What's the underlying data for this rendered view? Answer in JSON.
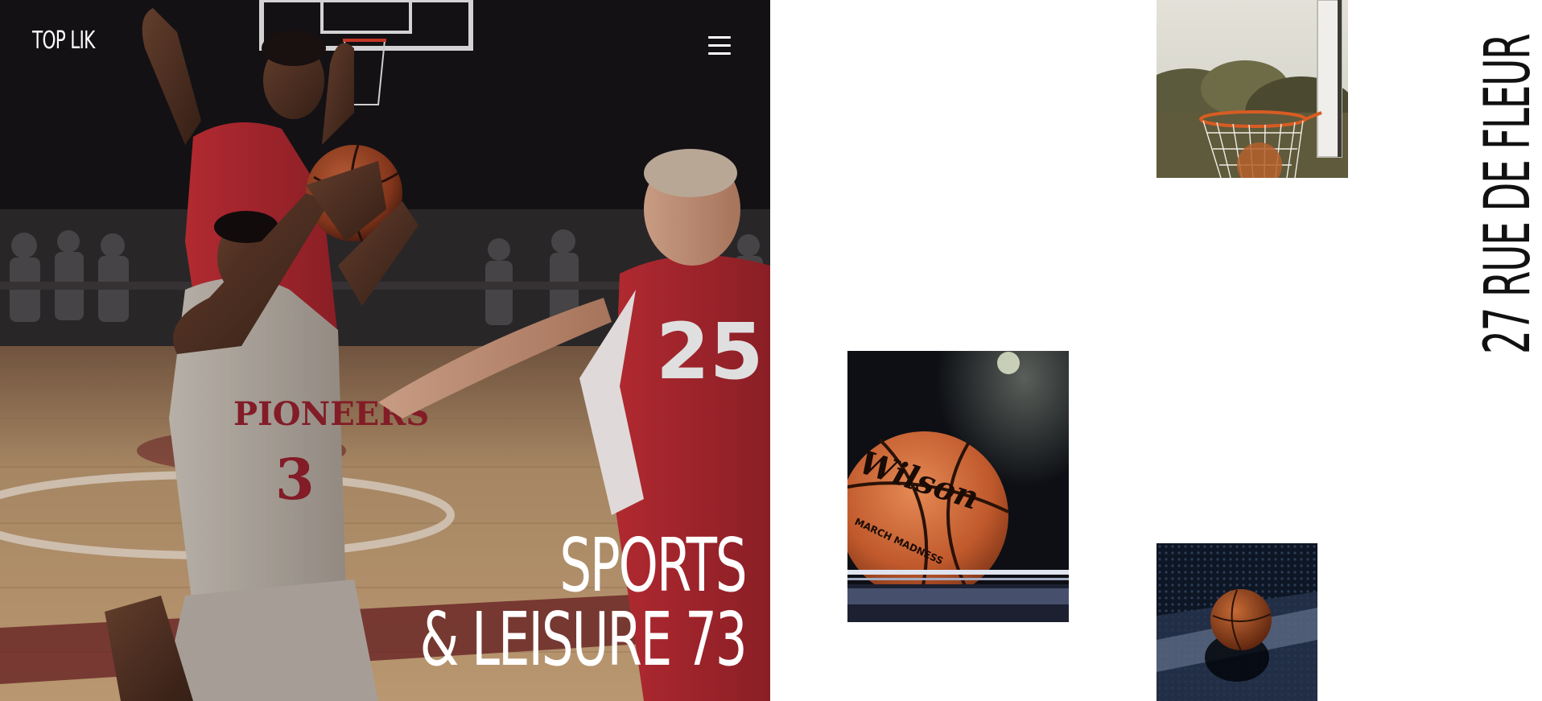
{
  "header": {
    "brand": "TOP LIK",
    "menu_icon": "hamburger-menu-icon"
  },
  "hero": {
    "title_line1": "SPORTS",
    "title_line2": "& LEISURE 73",
    "image": "basketball-players-game-photo",
    "jersey_front_team": "PIONEERS",
    "jersey_front_number": "3",
    "jersey_defender_number": "25"
  },
  "gallery": {
    "images": [
      "basketball-hoop-photo",
      "wilson-basketball-photo",
      "basketball-on-court-photo"
    ],
    "ball_brand": "Wilson",
    "ball_marking": "MARCH MADNESS"
  },
  "address": "27 RUE DE FLEUR",
  "colors": {
    "hero_background": "#151316",
    "page_background": "#ffffff",
    "title_text": "#ffffff",
    "address_text": "#111111",
    "jersey_red": "#b3252e"
  }
}
